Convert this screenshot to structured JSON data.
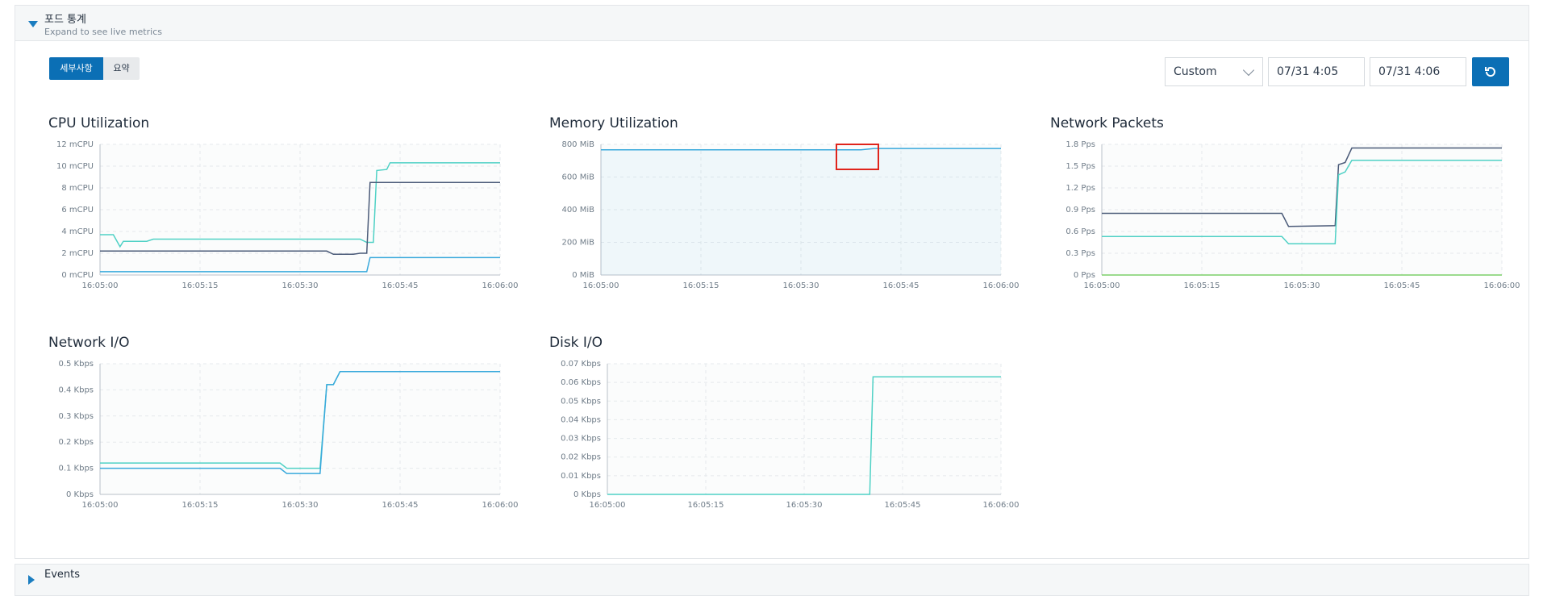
{
  "stats_section": {
    "title": "포드 통계",
    "subtitle": "Expand to see live metrics"
  },
  "toolbar": {
    "detail_tab": "세부사항",
    "summary_tab": "요약",
    "range_value": "Custom",
    "start_value": "07/31 4:05",
    "end_value": "07/31 4:06",
    "refresh_icon": "refresh-icon"
  },
  "events_section": {
    "title": "Events"
  },
  "colors": {
    "accent": "#0b6fb5",
    "series_teal": "#4fd1c5",
    "series_dark": "#4a5a78",
    "series_blue": "#39a9dc",
    "series_green": "#7ccf6a",
    "highlight": "#e0241b"
  },
  "x_ticks": [
    "16:05:00",
    "16:05:15",
    "16:05:30",
    "16:05:45",
    "16:06:00"
  ],
  "chart_data": [
    {
      "id": "cpu",
      "type": "line",
      "title": "CPU Utilization",
      "x_domain": [
        0,
        60
      ],
      "ylim": [
        0,
        12
      ],
      "y_ticks": [
        {
          "v": 0,
          "label": "0 mCPU"
        },
        {
          "v": 2,
          "label": "2 mCPU"
        },
        {
          "v": 4,
          "label": "4 mCPU"
        },
        {
          "v": 6,
          "label": "6 mCPU"
        },
        {
          "v": 8,
          "label": "8 mCPU"
        },
        {
          "v": 10,
          "label": "10 mCPU"
        },
        {
          "v": 12,
          "label": "12 mCPU"
        }
      ],
      "series": [
        {
          "color": "#4fd1c5",
          "points": [
            [
              0,
              3.7
            ],
            [
              2,
              3.7
            ],
            [
              3,
              2.6
            ],
            [
              3.5,
              3.1
            ],
            [
              7,
              3.1
            ],
            [
              8,
              3.3
            ],
            [
              39,
              3.3
            ],
            [
              40,
              3.0
            ],
            [
              41,
              3.0
            ],
            [
              41.5,
              9.6
            ],
            [
              43,
              9.7
            ],
            [
              43.5,
              10.3
            ],
            [
              60,
              10.3
            ]
          ]
        },
        {
          "color": "#4a5a78",
          "points": [
            [
              0,
              2.2
            ],
            [
              34,
              2.2
            ],
            [
              35,
              1.9
            ],
            [
              38,
              1.9
            ],
            [
              39,
              2.0
            ],
            [
              40,
              2.0
            ],
            [
              40.5,
              8.5
            ],
            [
              60,
              8.5
            ]
          ]
        },
        {
          "color": "#39a9dc",
          "points": [
            [
              0,
              0.3
            ],
            [
              39,
              0.3
            ],
            [
              40,
              0.3
            ],
            [
              40.5,
              1.6
            ],
            [
              60,
              1.6
            ]
          ]
        }
      ]
    },
    {
      "id": "memory",
      "type": "area",
      "title": "Memory Utilization",
      "x_domain": [
        0,
        60
      ],
      "ylim": [
        0,
        800
      ],
      "y_ticks": [
        {
          "v": 0,
          "label": "0 MiB"
        },
        {
          "v": 200,
          "label": "200 MiB"
        },
        {
          "v": 400,
          "label": "400 MiB"
        },
        {
          "v": 600,
          "label": "600 MiB"
        },
        {
          "v": 800,
          "label": "800 MiB"
        }
      ],
      "series": [
        {
          "color": "#39a9dc",
          "fill": true,
          "points": [
            [
              0,
              767
            ],
            [
              39,
              767
            ],
            [
              41,
              775
            ],
            [
              60,
              775
            ]
          ]
        }
      ]
    },
    {
      "id": "packets",
      "type": "line",
      "title": "Network Packets",
      "x_domain": [
        0,
        60
      ],
      "ylim": [
        0,
        1.8
      ],
      "y_ticks": [
        {
          "v": 0,
          "label": "0 Pps"
        },
        {
          "v": 0.3,
          "label": "0.3 Pps"
        },
        {
          "v": 0.6,
          "label": "0.6 Pps"
        },
        {
          "v": 0.9,
          "label": "0.9 Pps"
        },
        {
          "v": 1.2,
          "label": "1.2 Pps"
        },
        {
          "v": 1.5,
          "label": "1.5 Pps"
        },
        {
          "v": 1.8,
          "label": "1.8 Pps"
        }
      ],
      "series": [
        {
          "color": "#4a5a78",
          "points": [
            [
              0,
              0.85
            ],
            [
              27,
              0.85
            ],
            [
              28,
              0.67
            ],
            [
              35,
              0.68
            ],
            [
              35.5,
              1.52
            ],
            [
              36.5,
              1.55
            ],
            [
              37.5,
              1.75
            ],
            [
              60,
              1.75
            ]
          ]
        },
        {
          "color": "#4fd1c5",
          "points": [
            [
              0,
              0.53
            ],
            [
              27,
              0.53
            ],
            [
              28,
              0.43
            ],
            [
              35,
              0.43
            ],
            [
              35.5,
              1.38
            ],
            [
              36.5,
              1.42
            ],
            [
              37.5,
              1.58
            ],
            [
              60,
              1.58
            ]
          ]
        },
        {
          "color": "#7ccf6a",
          "points": [
            [
              0,
              0.0
            ],
            [
              60,
              0.0
            ]
          ]
        }
      ]
    },
    {
      "id": "netio",
      "type": "line",
      "title": "Network I/O",
      "x_domain": [
        0,
        60
      ],
      "ylim": [
        0,
        0.5
      ],
      "y_ticks": [
        {
          "v": 0,
          "label": "0 Kbps"
        },
        {
          "v": 0.1,
          "label": "0.1 Kbps"
        },
        {
          "v": 0.2,
          "label": "0.2 Kbps"
        },
        {
          "v": 0.3,
          "label": "0.3 Kbps"
        },
        {
          "v": 0.4,
          "label": "0.4 Kbps"
        },
        {
          "v": 0.5,
          "label": "0.5 Kbps"
        }
      ],
      "series": [
        {
          "color": "#4fd1c5",
          "points": [
            [
              0,
              0.12
            ],
            [
              27,
              0.12
            ],
            [
              28,
              0.1
            ],
            [
              33,
              0.1
            ],
            [
              34,
              0.42
            ],
            [
              35,
              0.42
            ],
            [
              36,
              0.47
            ],
            [
              60,
              0.47
            ]
          ]
        },
        {
          "color": "#39a9dc",
          "points": [
            [
              0,
              0.1
            ],
            [
              27,
              0.1
            ],
            [
              28,
              0.08
            ],
            [
              33,
              0.08
            ],
            [
              34,
              0.42
            ],
            [
              35,
              0.42
            ],
            [
              36,
              0.47
            ],
            [
              60,
              0.47
            ]
          ]
        }
      ]
    },
    {
      "id": "disk",
      "type": "line",
      "title": "Disk I/O",
      "x_domain": [
        0,
        60
      ],
      "ylim": [
        0,
        0.07
      ],
      "y_ticks": [
        {
          "v": 0,
          "label": "0 Kbps"
        },
        {
          "v": 0.01,
          "label": "0.01 Kbps"
        },
        {
          "v": 0.02,
          "label": "0.02 Kbps"
        },
        {
          "v": 0.03,
          "label": "0.03 Kbps"
        },
        {
          "v": 0.04,
          "label": "0.04 Kbps"
        },
        {
          "v": 0.05,
          "label": "0.05 Kbps"
        },
        {
          "v": 0.06,
          "label": "0.06 Kbps"
        },
        {
          "v": 0.07,
          "label": "0.07 Kbps"
        }
      ],
      "series": [
        {
          "color": "#4fd1c5",
          "points": [
            [
              0,
              0
            ],
            [
              40,
              0
            ],
            [
              40.5,
              0.063
            ],
            [
              60,
              0.063
            ]
          ]
        }
      ]
    }
  ]
}
